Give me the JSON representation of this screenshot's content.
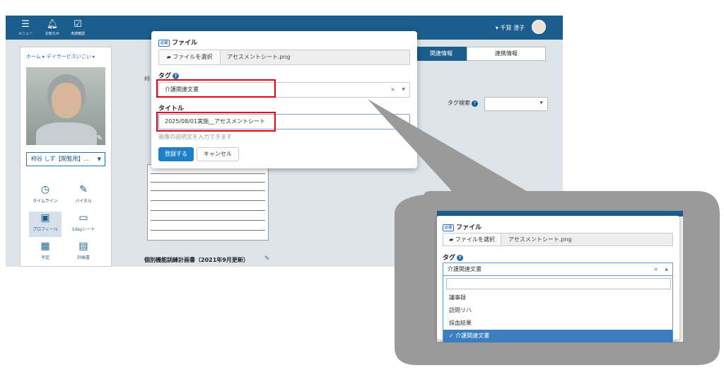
{
  "topbar": {
    "menu_label": "メニュー",
    "notify_label": "お知らせ",
    "unchecked_label": "未読確認",
    "user_name": "▾ 千賀 澄子"
  },
  "sidebar": {
    "breadcrumb": "ホーム ▸ デイサービスいこい ▸",
    "resident_select": "柿谷 しず【閲覧用】...",
    "nav": [
      {
        "label": "タイムライン"
      },
      {
        "label": "バイタル"
      },
      {
        "label": "プロフィール"
      },
      {
        "label": "1dayシート"
      },
      {
        "label": "予定"
      },
      {
        "label": "計画書"
      }
    ]
  },
  "main": {
    "tab_related": "関連情報",
    "tab_linked": "連携情報",
    "tag_search_label": "タグ検索",
    "left_stub": "柿",
    "doc_title": "個別機能訓練計画書（2021年9月更新）"
  },
  "modal": {
    "required_badge": "必須",
    "file_label": "ファイル",
    "file_button": "ファイルを選択",
    "file_name": "アセスメントシート.png",
    "tag_label": "タグ",
    "tag_value": "介護関連文書",
    "title_label": "タイトル",
    "title_value": "2025/08/01実施__アセスメントシート",
    "help_text": "画像の説明文を入力できます",
    "submit": "登録する",
    "cancel": "キャンセル"
  },
  "zoom": {
    "required_badge": "必須",
    "file_label": "ファイル",
    "file_button": "ファイルを選択",
    "file_name": "アセスメントシート.png",
    "tag_label": "タグ",
    "tag_value": "介護関連文書",
    "options": [
      "議事録",
      "訪問リハ",
      "採血結果",
      "介護関連文書"
    ],
    "selected_index": 3
  },
  "colors": {
    "brand": "#1b5d8c",
    "primary_button": "#1f7fc7",
    "highlight": "#e60012",
    "callout": "#9a9a9a",
    "dropdown_selected": "#3b7dbf"
  }
}
